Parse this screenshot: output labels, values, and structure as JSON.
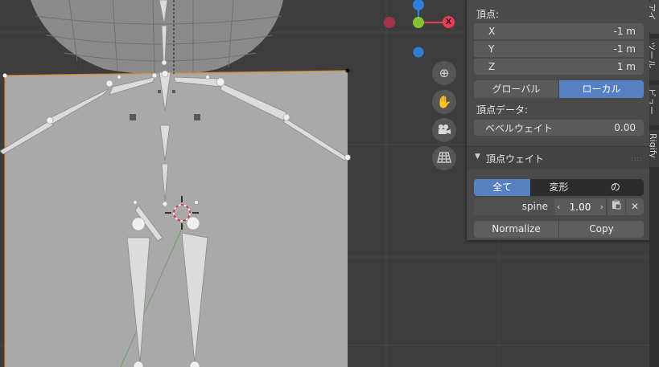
{
  "gizmo": {
    "x_label": "X",
    "colors": {
      "x": "#f03a53",
      "y": "#86c332",
      "z": "#2f7fd6",
      "x_neg": "#a23446",
      "z_neg": "#3c5d8a"
    }
  },
  "nav_buttons": [
    {
      "icon": "zoom-icon",
      "glyph": "⊕"
    },
    {
      "icon": "hand-pan-icon",
      "glyph": "✋"
    },
    {
      "icon": "camera-icon",
      "glyph": "🎥"
    },
    {
      "icon": "grid-perspective-icon",
      "glyph": "▦"
    }
  ],
  "panel": {
    "vertex_label": "頂点:",
    "coords": [
      {
        "axis": "X",
        "value": "-1 m"
      },
      {
        "axis": "Y",
        "value": "-1 m"
      },
      {
        "axis": "Z",
        "value": "1 m"
      }
    ],
    "space_toggle": {
      "global": "グローバル",
      "local": "ローカル",
      "active": "local"
    },
    "vertex_data_label": "頂点データ:",
    "bevel_weight": {
      "label": "ベベルウェイト",
      "value": "0.00"
    },
    "weights_section": {
      "title": "頂点ウェイト",
      "filters": [
        "全て",
        "変形",
        "の"
      ],
      "active_filter": 0,
      "group": {
        "name": "spine",
        "value": "1.00"
      },
      "normalize": "Normalize",
      "copy": "Copy"
    }
  },
  "side_tabs": [
    {
      "label": "アイ"
    },
    {
      "label": "ツール"
    },
    {
      "label": "ビュー"
    },
    {
      "label": "Rigify"
    }
  ]
}
